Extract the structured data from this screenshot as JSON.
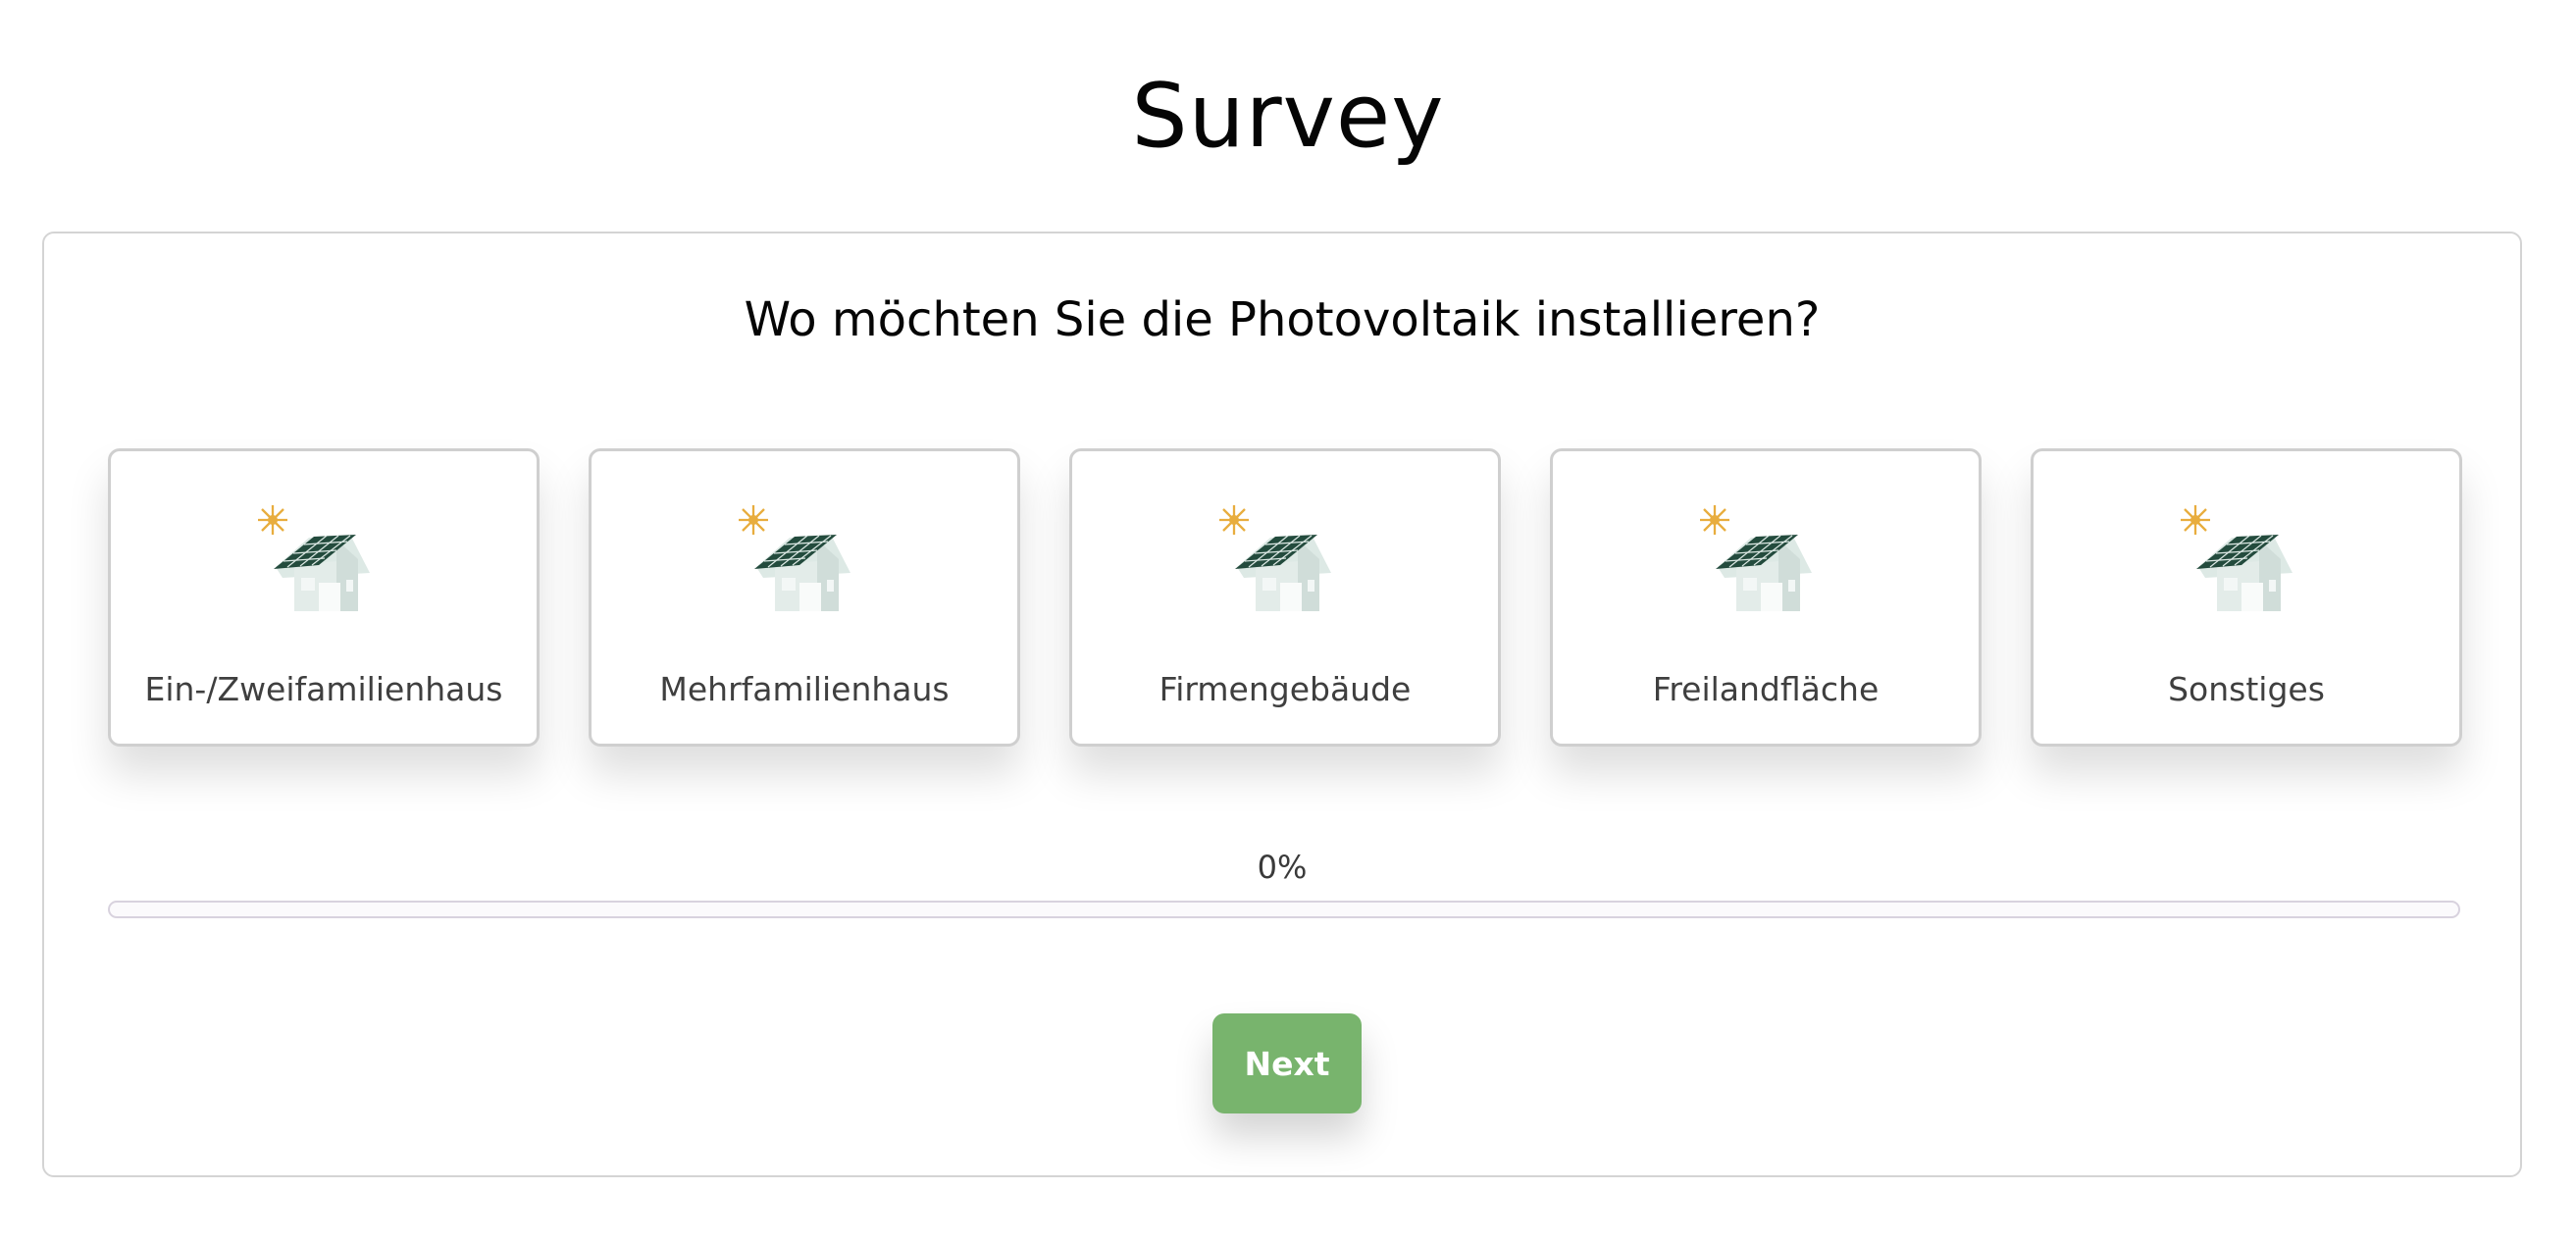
{
  "page": {
    "title": "Survey"
  },
  "survey": {
    "question": "Wo möchten Sie die Photovoltaik installieren?",
    "options": [
      {
        "label": "Ein-/Zweifamilienhaus",
        "icon": "house-solar-icon"
      },
      {
        "label": "Mehrfamilienhaus",
        "icon": "house-solar-icon"
      },
      {
        "label": "Firmengebäude",
        "icon": "house-solar-icon"
      },
      {
        "label": "Freilandfläche",
        "icon": "house-solar-icon"
      },
      {
        "label": "Sonstiges",
        "icon": "house-solar-icon"
      }
    ],
    "progress": {
      "label": "0%",
      "value": 0
    },
    "next_label": "Next"
  },
  "colors": {
    "accent": "#78b46d",
    "sun": "#e8ad3e",
    "panel": "#234b3d",
    "house": "#dde9e5"
  }
}
